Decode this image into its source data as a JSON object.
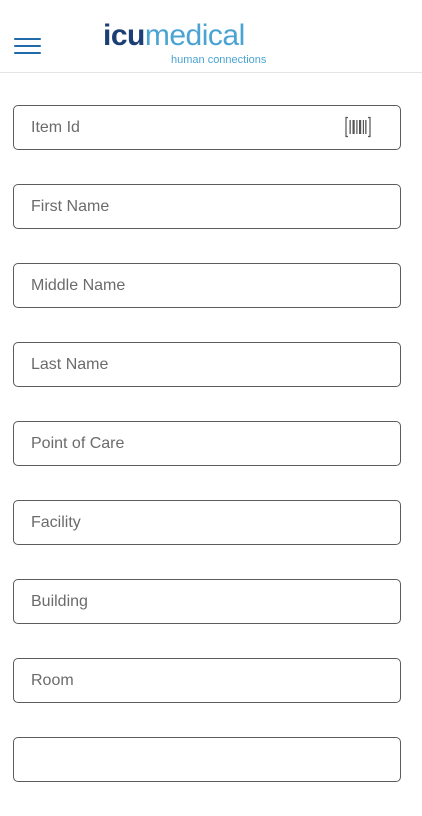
{
  "header": {
    "menu_icon": "hamburger-menu-icon",
    "logo": {
      "brand_bold": "icu",
      "brand_light": "medical",
      "tagline": "human connections"
    },
    "colors": {
      "brand_dark": "#1b3f74",
      "brand_light": "#4ba3d3",
      "menu": "#1f6aa8"
    }
  },
  "form": {
    "fields": [
      {
        "name": "item-id-input",
        "placeholder": "Item Id",
        "value": "",
        "icon": "barcode-icon"
      },
      {
        "name": "first-name-input",
        "placeholder": "First Name",
        "value": ""
      },
      {
        "name": "middle-name-input",
        "placeholder": "Middle Name",
        "value": ""
      },
      {
        "name": "last-name-input",
        "placeholder": "Last Name",
        "value": ""
      },
      {
        "name": "point-of-care-input",
        "placeholder": "Point of Care",
        "value": ""
      },
      {
        "name": "facility-input",
        "placeholder": "Facility",
        "value": ""
      },
      {
        "name": "building-input",
        "placeholder": "Building",
        "value": ""
      },
      {
        "name": "room-input",
        "placeholder": "Room",
        "value": ""
      },
      {
        "name": "partial-field-input",
        "placeholder": "",
        "value": ""
      }
    ]
  }
}
